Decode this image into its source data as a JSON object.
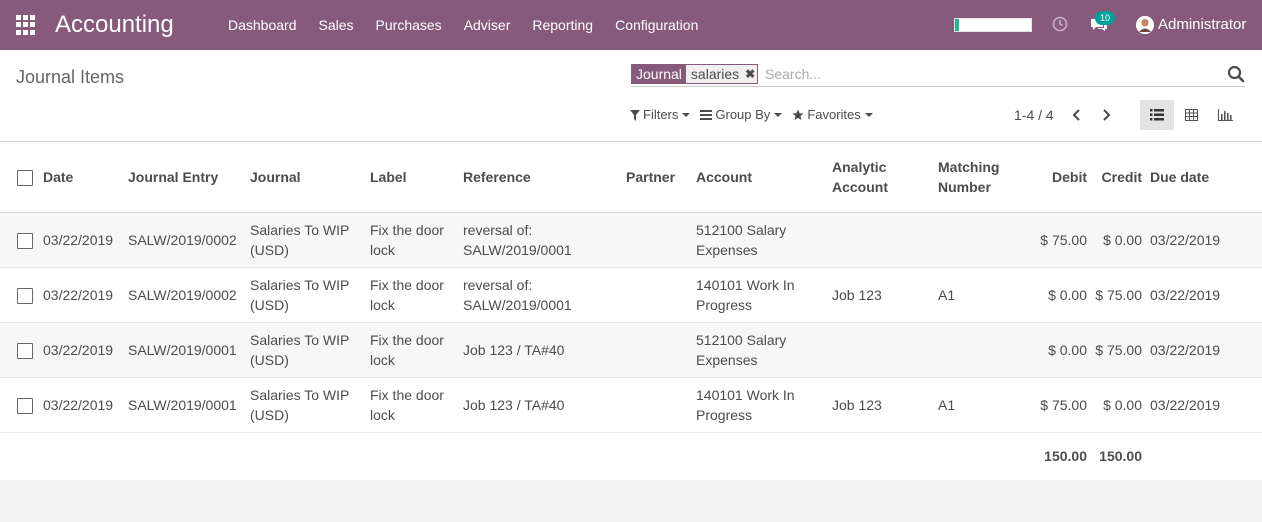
{
  "app": {
    "brand": "Accounting",
    "menu": [
      "Dashboard",
      "Sales",
      "Purchases",
      "Adviser",
      "Reporting",
      "Configuration"
    ],
    "progress_fraction": 0.05,
    "notification_count": "10",
    "user_name": "Administrator",
    "colors": {
      "navbar": "#875a7b",
      "badge": "#00a09d",
      "progress": "#21b799"
    }
  },
  "control_panel": {
    "breadcrumb": "Journal Items",
    "facet": {
      "category": "Journal",
      "value": "salaries"
    },
    "search_placeholder": "Search...",
    "filters_label": "Filters",
    "group_by_label": "Group By",
    "favorites_label": "Favorites",
    "pager": "1-4 / 4",
    "active_view": "list"
  },
  "table": {
    "headers": {
      "date": "Date",
      "journal_entry": "Journal Entry",
      "journal": "Journal",
      "label": "Label",
      "reference": "Reference",
      "partner": "Partner",
      "account": "Account",
      "analytic_account": "Analytic Account",
      "matching_number": "Matching Number",
      "debit": "Debit",
      "credit": "Credit",
      "due_date": "Due date"
    },
    "rows": [
      {
        "date": "03/22/2019",
        "journal_entry": "SALW/2019/0002",
        "journal": "Salaries To WIP (USD)",
        "label": "Fix the door lock",
        "reference": "reversal of: SALW/2019/0001",
        "partner": "",
        "account": "512100 Salary Expenses",
        "analytic_account": "",
        "matching_number": "",
        "debit": "$ 75.00",
        "credit": "$ 0.00",
        "due_date": "03/22/2019"
      },
      {
        "date": "03/22/2019",
        "journal_entry": "SALW/2019/0002",
        "journal": "Salaries To WIP (USD)",
        "label": "Fix the door lock",
        "reference": "reversal of: SALW/2019/0001",
        "partner": "",
        "account": "140101 Work In Progress",
        "analytic_account": "Job 123",
        "matching_number": "A1",
        "debit": "$ 0.00",
        "credit": "$ 75.00",
        "due_date": "03/22/2019"
      },
      {
        "date": "03/22/2019",
        "journal_entry": "SALW/2019/0001",
        "journal": "Salaries To WIP (USD)",
        "label": "Fix the door lock",
        "reference": "Job 123 / TA#40",
        "partner": "",
        "account": "512100 Salary Expenses",
        "analytic_account": "",
        "matching_number": "",
        "debit": "$ 0.00",
        "credit": "$ 75.00",
        "due_date": "03/22/2019"
      },
      {
        "date": "03/22/2019",
        "journal_entry": "SALW/2019/0001",
        "journal": "Salaries To WIP (USD)",
        "label": "Fix the door lock",
        "reference": "Job 123 / TA#40",
        "partner": "",
        "account": "140101 Work In Progress",
        "analytic_account": "Job 123",
        "matching_number": "A1",
        "debit": "$ 75.00",
        "credit": "$ 0.00",
        "due_date": "03/22/2019"
      }
    ],
    "totals": {
      "debit": "150.00",
      "credit": "150.00"
    }
  }
}
